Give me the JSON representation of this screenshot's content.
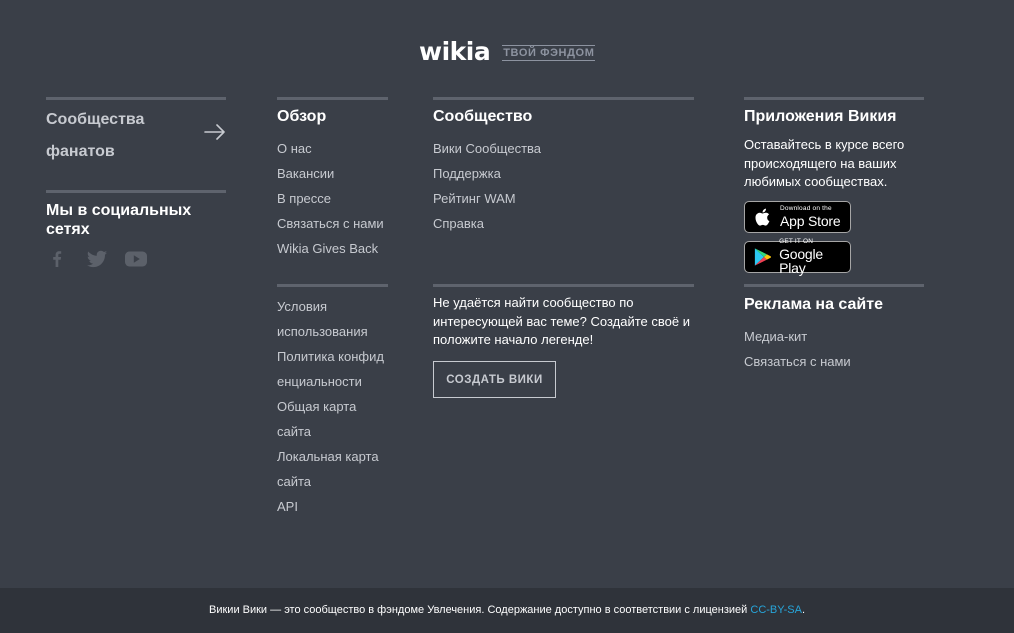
{
  "header": {
    "logo_text": "wikia",
    "tagline": "ТВОЙ ФЭНДОМ"
  },
  "fan_communities": {
    "label": "Сообщества фанатов",
    "icon": "arrow-right-icon"
  },
  "social": {
    "title": "Мы в социальных сетях",
    "icons": [
      "facebook-icon",
      "twitter-icon",
      "youtube-icon"
    ]
  },
  "overview": {
    "heading": "Обзор",
    "links": [
      "О нас",
      "Вакансии",
      "В прессе",
      "Связаться с нами",
      "Wikia Gives Back"
    ]
  },
  "legal_links": {
    "links": [
      "Условия использования",
      "Политика конфиденциальности",
      "Общая карта сайта",
      "Локальная карта сайта",
      "API"
    ]
  },
  "community": {
    "heading": "Сообщество",
    "links": [
      "Вики Сообщества",
      "Поддержка",
      "Рейтинг WAM",
      "Справка"
    ],
    "prompt": "Не удаётся найти сообщество по интересующей вас теме? Создайте своё и положите начало легенде!",
    "create_button": "СОЗДАТЬ ВИКИ"
  },
  "apps": {
    "heading": "Приложения Викия",
    "description": "Оставайтесь в курсе всего происходящего на ваших любимых сообществах.",
    "app_store": {
      "small": "Download on the",
      "big": "App Store",
      "icon": "apple-icon"
    },
    "google_play": {
      "small": "GET IT ON",
      "big": "Google Play",
      "icon": "google-play-icon"
    }
  },
  "advertising": {
    "heading": "Реклама на сайте",
    "links": [
      "Медиа-кит",
      "Связаться с нами"
    ]
  },
  "legal_bar": {
    "text": "Викии Вики — это сообщество в фэндоме Увлечения. Содержание доступно в соответствии с лицензией ",
    "license_link": "CC-BY-SA",
    "suffix": "."
  },
  "colors": {
    "background": "#3a3f48",
    "legal_background": "#2f333a",
    "rule": "#5e636d",
    "link": "#c7cad0",
    "accent_link": "#27a5d9"
  }
}
